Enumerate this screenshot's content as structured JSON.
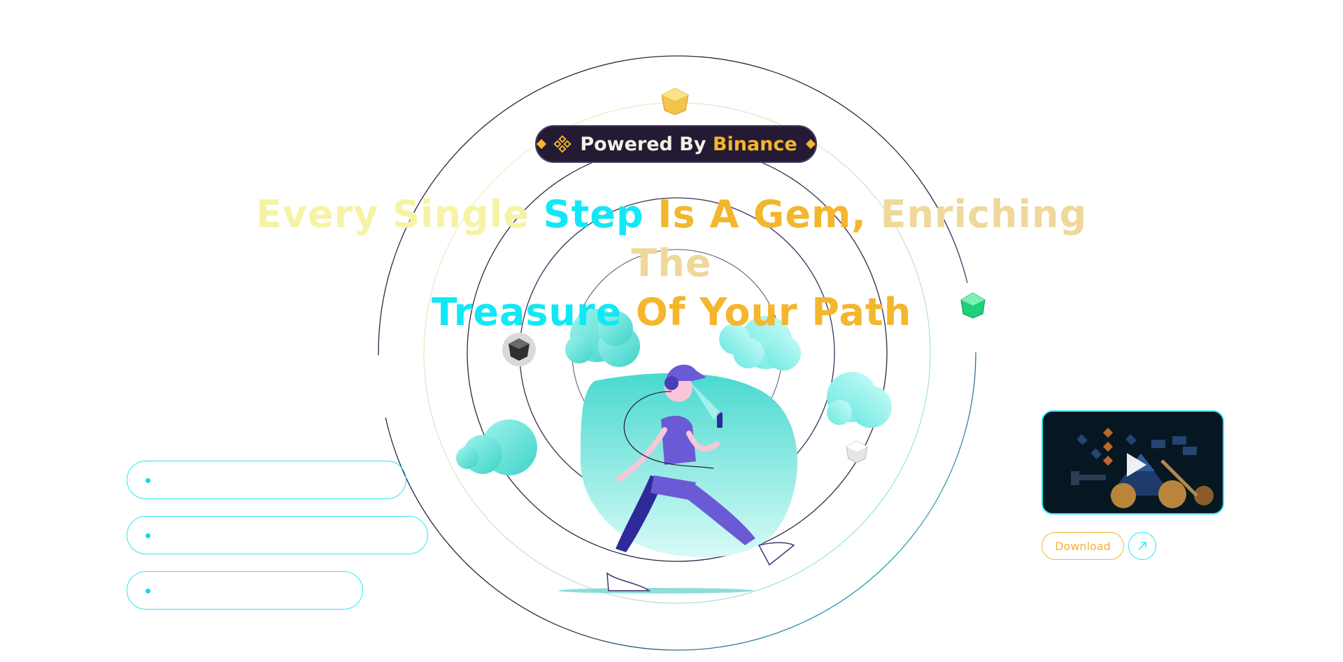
{
  "badge": {
    "text_part1": "Powered By",
    "text_part2": "Binance",
    "logo_icon": "binance-logo-icon"
  },
  "headline": {
    "segments": [
      {
        "text": "Every Single ",
        "color": "#f6f3a6"
      },
      {
        "text": "Step",
        "color": "#12e8f5"
      },
      {
        "text": " Is A Gem, ",
        "color": "#f3b62c"
      },
      {
        "text": "Enriching The",
        "color": "#efd89a"
      },
      {
        "text": "Treasure",
        "color": "#12e8f5"
      },
      {
        "text": " Of Your Path",
        "color": "#f3b62c"
      }
    ]
  },
  "sidebar_pills": [
    {
      "label": ""
    },
    {
      "label": ""
    },
    {
      "label": ""
    }
  ],
  "video": {
    "play_icon": "play-icon",
    "thumbnail": "mining-illustration"
  },
  "download": {
    "label": "Download",
    "arrow_icon": "arrow-up-right-icon"
  },
  "colors": {
    "accent_cyan": "#2ee6f2",
    "accent_gold": "#f3b62c",
    "badge_bg": "#241a33",
    "orbit_dark": "#2d2542"
  },
  "gems": [
    {
      "name": "gold-gem-icon",
      "color": "#f0c54a"
    },
    {
      "name": "green-gem-icon",
      "color": "#1fcf7a"
    },
    {
      "name": "black-gem-icon",
      "color": "#3a3a3a"
    },
    {
      "name": "silver-gem-icon",
      "color": "#d8d8d8"
    }
  ]
}
